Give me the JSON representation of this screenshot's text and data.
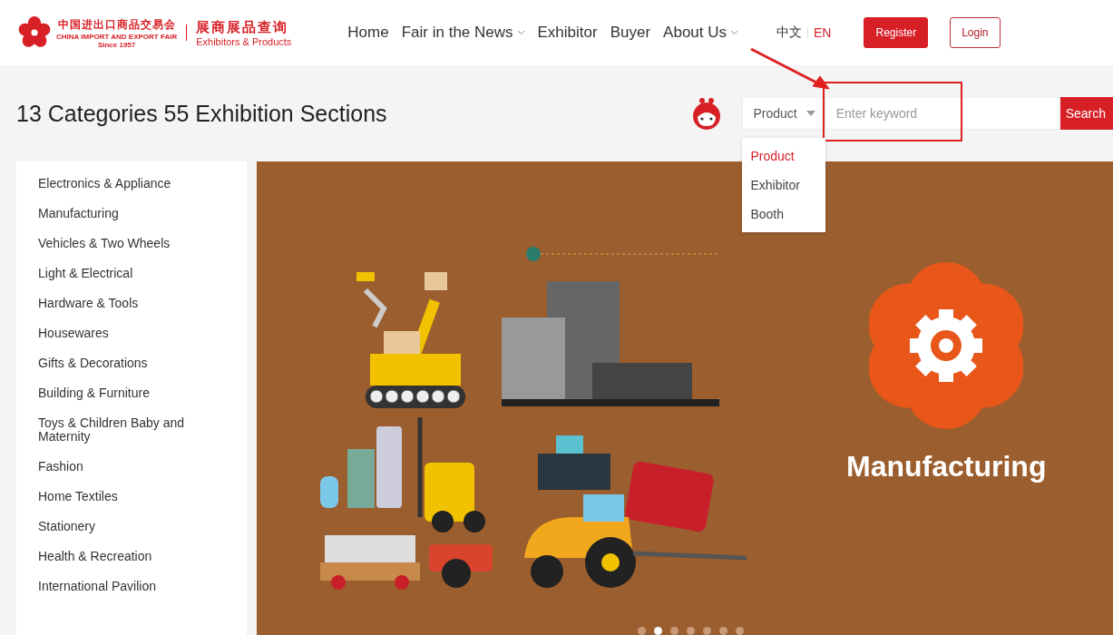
{
  "header": {
    "logo": {
      "chinese": "中国进出口商品交易会",
      "english": "CHINA IMPORT AND EXPORT FAIR",
      "since": "Since 1957"
    },
    "subtitle": {
      "chinese": "展商展品查询",
      "english": "Exhibitors & Products"
    },
    "nav": [
      {
        "label": "Home",
        "has_menu": false
      },
      {
        "label": "Fair in the News",
        "has_menu": true
      },
      {
        "label": "Exhibitor",
        "has_menu": false
      },
      {
        "label": "Buyer",
        "has_menu": false
      },
      {
        "label": "About Us",
        "has_menu": true
      }
    ],
    "languages": [
      {
        "label": "中文",
        "selected": false
      },
      {
        "label": "EN",
        "selected": true
      }
    ],
    "buttons": [
      {
        "label": "Register",
        "kind": "primary"
      },
      {
        "label": "Login",
        "kind": "outline"
      }
    ]
  },
  "page_title": "13 Categories 55 Exhibition Sections",
  "search": {
    "type_value": "Product",
    "placeholder": "Enter keyword",
    "button": "Search",
    "highlighted": true,
    "dropdown": [
      {
        "label": "Product",
        "selected": true
      },
      {
        "label": "Exhibitor",
        "selected": false
      },
      {
        "label": "Booth",
        "selected": false
      }
    ]
  },
  "sidebar": {
    "items": [
      "Electronics & Appliance",
      "Manufacturing",
      "Vehicles & Two Wheels",
      "Light & Electrical",
      "Hardware & Tools",
      "Housewares",
      "Gifts & Decorations",
      "Building & Furniture",
      "Toys & Children Baby and Maternity",
      "Fashion",
      "Home Textiles",
      "Stationery",
      "Health & Recreation",
      "International Pavilion"
    ]
  },
  "banner": {
    "title": "Manufacturing",
    "dots": [
      {
        "selected": false
      },
      {
        "selected": true
      },
      {
        "selected": false
      },
      {
        "selected": false
      },
      {
        "selected": false
      },
      {
        "selected": false
      },
      {
        "selected": false
      }
    ]
  }
}
